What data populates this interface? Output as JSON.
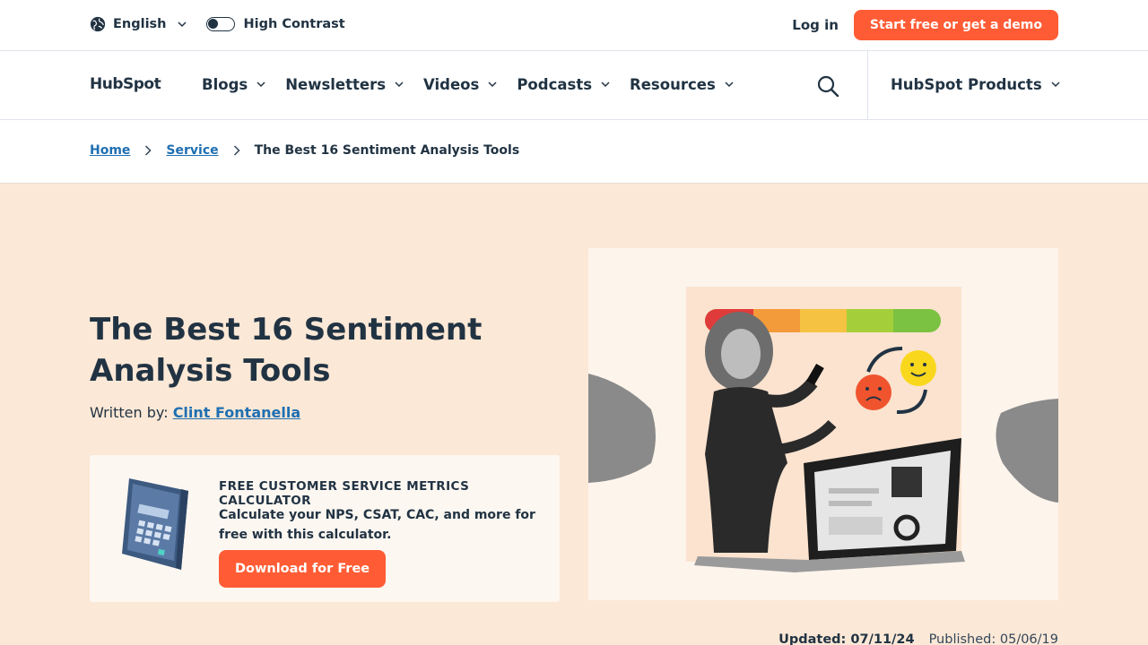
{
  "utility": {
    "language": "English",
    "high_contrast": "High Contrast",
    "login": "Log in",
    "cta": "Start free or get a demo"
  },
  "nav": {
    "logo": "HubSpot",
    "items": [
      "Blogs",
      "Newsletters",
      "Videos",
      "Podcasts",
      "Resources"
    ],
    "products": "HubSpot Products"
  },
  "breadcrumb": {
    "home": "Home",
    "section": "Service",
    "current": "The Best 16 Sentiment Analysis Tools"
  },
  "article": {
    "title": "The Best 16 Sentiment Analysis Tools",
    "written_by": "Written by:",
    "author": "Clint Fontanella",
    "updated_label": "Updated:",
    "updated_date": "07/11/24",
    "published_label": "Published:",
    "published_date": "05/06/19"
  },
  "offer": {
    "title": "FREE CUSTOMER SERVICE METRICS CALCULATOR",
    "description": "Calculate your NPS, CSAT, CAC, and more for free with this calculator.",
    "button": "Download for Free"
  },
  "colors": {
    "accent": "#ff5c35",
    "hero_bg": "#fce8d6",
    "link": "#1f6fb2",
    "text": "#213343"
  }
}
